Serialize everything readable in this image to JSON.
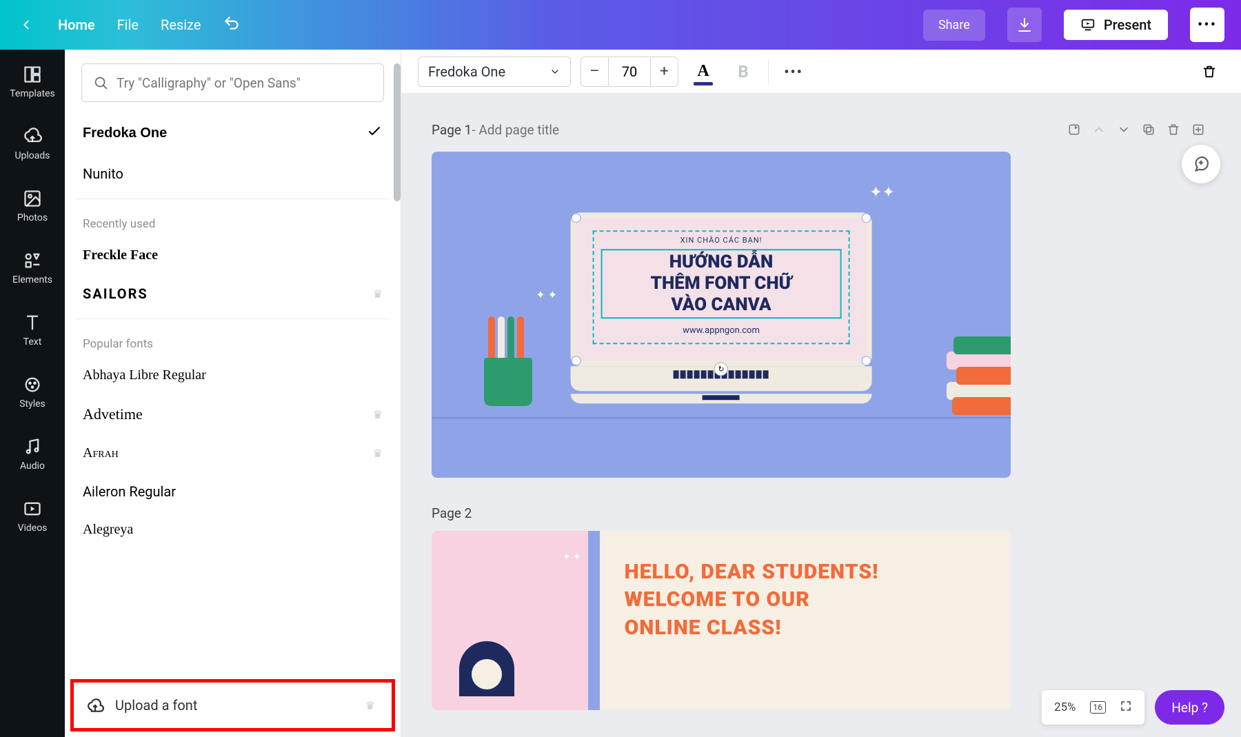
{
  "topbar": {
    "home": "Home",
    "file": "File",
    "resize": "Resize",
    "share": "Share",
    "present": "Present"
  },
  "rail": {
    "templates": "Templates",
    "uploads": "Uploads",
    "photos": "Photos",
    "elements": "Elements",
    "text": "Text",
    "styles": "Styles",
    "audio": "Audio",
    "videos": "Videos"
  },
  "panel": {
    "search_placeholder": "Try \"Calligraphy\" or \"Open Sans\"",
    "current_font": "Fredoka One",
    "nunito": "Nunito",
    "recently_used_label": "Recently used",
    "freckle": "Freckle Face",
    "sailors": "SAILORS",
    "popular_label": "Popular fonts",
    "abhaya": "Abhaya Libre Regular",
    "advetime": "Advetime",
    "afrah": "Afrah",
    "aileron": "Aileron Regular",
    "alegreya": "Alegreya",
    "upload": "Upload a font"
  },
  "ctoolbar": {
    "font": "Fredoka One",
    "size": "70"
  },
  "page1": {
    "label": "Page 1",
    "title_placeholder": " - Add page title",
    "sub": "XIN CHÀO CÁC BẠN!",
    "line1": "HƯỚNG DẪN",
    "line2": "THÊM FONT CHỮ",
    "line3": "VÀO CANVA",
    "url": "www.appngon.com"
  },
  "page2": {
    "label": "Page 2",
    "line1": "HELLO, DEAR STUDENTS!",
    "line2": "WELCOME TO OUR",
    "line3": "ONLINE CLASS!"
  },
  "bottom": {
    "zoom": "25%",
    "pages": "16",
    "help": "Help ?"
  }
}
